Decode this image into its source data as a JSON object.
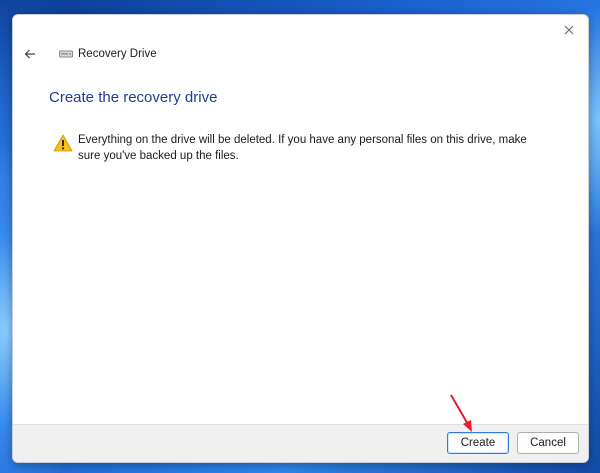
{
  "window": {
    "title": "Recovery Drive",
    "heading": "Create the recovery drive",
    "warning": "Everything on the drive will be deleted. If you have any personal files on this drive, make sure you've backed up the files."
  },
  "icons": {
    "close": "close-icon",
    "back": "back-arrow-icon",
    "drive": "drive-icon",
    "warning": "warning-icon",
    "annotation": "red-arrow-annotation"
  },
  "buttons": {
    "create": "Create",
    "cancel": "Cancel"
  },
  "colors": {
    "heading": "#1e3e91",
    "warning_fill": "#f6c21c",
    "annotation_arrow": "#e0202a",
    "primary_button_border": "#2f7bd8"
  }
}
